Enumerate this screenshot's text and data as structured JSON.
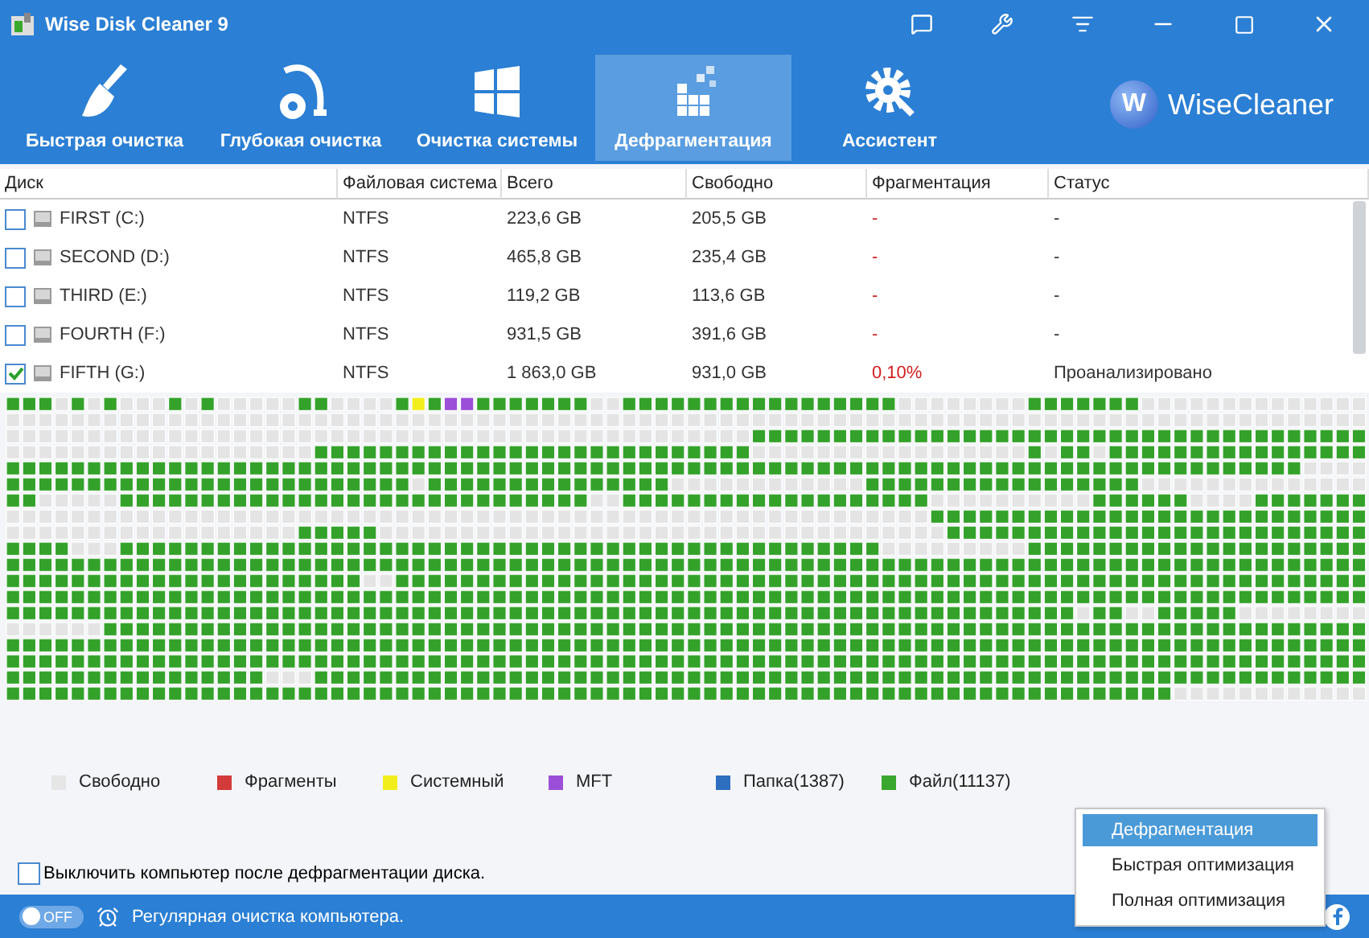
{
  "window": {
    "title": "Wise Disk Cleaner 9"
  },
  "nav": [
    {
      "label": "Быстрая очистка",
      "selected": false,
      "kind": "broom"
    },
    {
      "label": "Глубокая очистка",
      "selected": false,
      "kind": "vacuum"
    },
    {
      "label": "Очистка системы",
      "selected": false,
      "kind": "windows"
    },
    {
      "label": "Дефрагментация",
      "selected": true,
      "kind": "defrag"
    },
    {
      "label": "Ассистент",
      "selected": false,
      "kind": "gear"
    }
  ],
  "brand": {
    "letter": "W",
    "name": "WiseCleaner"
  },
  "table": {
    "columns": [
      "Диск",
      "Файловая система",
      "Всего",
      "Свободно",
      "Фрагментация",
      "Статус"
    ],
    "rows": [
      {
        "checked": false,
        "cells": [
          "FIRST (C:)",
          "NTFS",
          "223,6 GB",
          "205,5 GB",
          "-",
          "-"
        ]
      },
      {
        "checked": false,
        "cells": [
          "SECOND (D:)",
          "NTFS",
          "465,8 GB",
          "235,4 GB",
          "-",
          "-"
        ]
      },
      {
        "checked": false,
        "cells": [
          "THIRD (E:)",
          "NTFS",
          "119,2 GB",
          "113,6 GB",
          "-",
          "-"
        ]
      },
      {
        "checked": false,
        "cells": [
          "FOURTH (F:)",
          "NTFS",
          "931,5 GB",
          "391,6 GB",
          "-",
          "-"
        ]
      },
      {
        "checked": true,
        "cells": [
          "FIFTH (G:)",
          "NTFS",
          "1 863,0 GB",
          "931,0 GB",
          "0,10%",
          "Проанализировано"
        ]
      }
    ]
  },
  "legend": [
    {
      "label": "Свободно",
      "color": "#e6e6e6"
    },
    {
      "label": "Фрагменты",
      "color": "#d33a3a"
    },
    {
      "label": "Системный",
      "color": "#f2ee1e"
    },
    {
      "label": "MFT",
      "color": "#9b4fd8"
    },
    {
      "label": "Папка(1387)",
      "color": "#2e6fc0"
    },
    {
      "label": "Файл(11137)",
      "color": "#3aa82e"
    }
  ],
  "shutdown": {
    "label": "Выключить компьютер после дефрагментации диска.",
    "checked": false
  },
  "menu": [
    {
      "label": "Дефрагментация",
      "selected": true
    },
    {
      "label": "Быстрая оптимизация",
      "selected": false
    },
    {
      "label": "Полная оптимизация",
      "selected": false
    }
  ],
  "footer": {
    "toggle": {
      "on": false,
      "label": "OFF"
    },
    "schedule": "Регулярная очистка компьютера."
  }
}
